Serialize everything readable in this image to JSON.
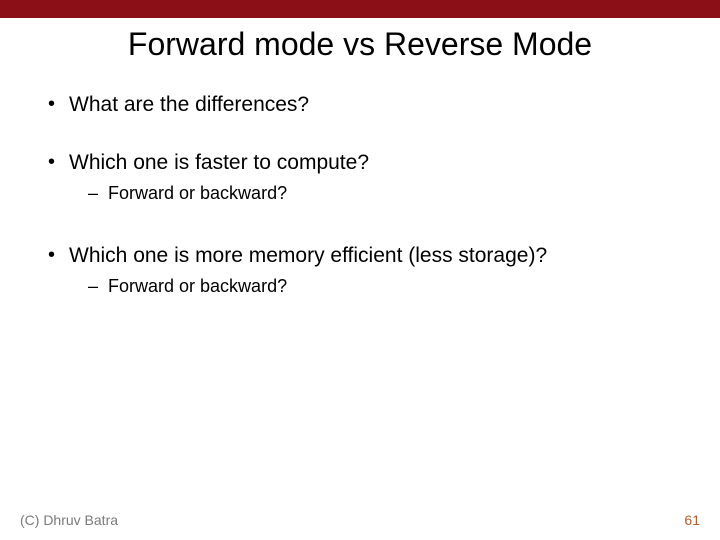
{
  "title": "Forward mode vs Reverse Mode",
  "bullets": {
    "b1": "What are the differences?",
    "b2": "Which one is faster to compute?",
    "b2a": "Forward or backward?",
    "b3": "Which one is more memory efficient (less storage)?",
    "b3a": "Forward or backward?"
  },
  "footer": {
    "copyright": "(C) Dhruv Batra",
    "page": "61"
  }
}
